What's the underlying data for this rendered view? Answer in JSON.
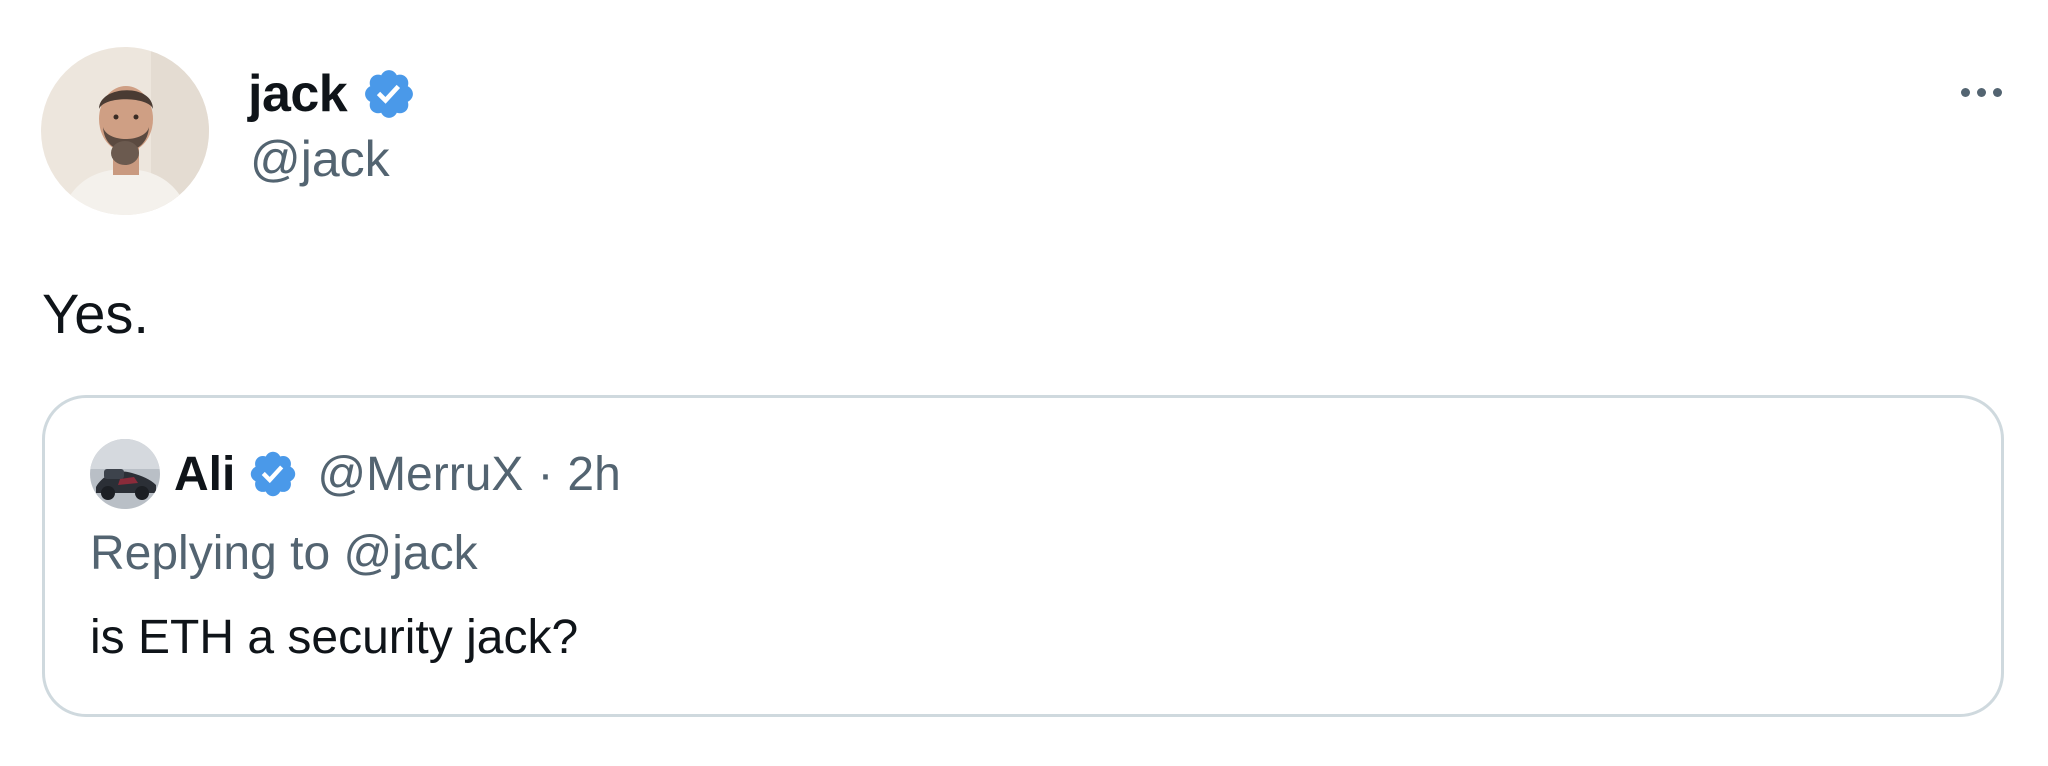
{
  "author": {
    "name": "jack",
    "handle": "@jack",
    "verified": true,
    "avatar_icon": "profile-photo-icon"
  },
  "more_icon": "ellipsis-icon",
  "tweet": {
    "text": "Yes."
  },
  "quoted_tweet": {
    "author_name": "Ali",
    "author_handle": "@MerruX",
    "separator": "·",
    "time": "2h",
    "verified": true,
    "avatar_icon": "profile-photo-icon",
    "replying_prefix": "Replying to",
    "replying_to": "@jack",
    "text": "is ETH a security jack?"
  },
  "colors": {
    "verified_blue": "#4a99e9",
    "text_primary": "#0f1419",
    "text_secondary": "#536471",
    "border": "#cfd9de"
  }
}
